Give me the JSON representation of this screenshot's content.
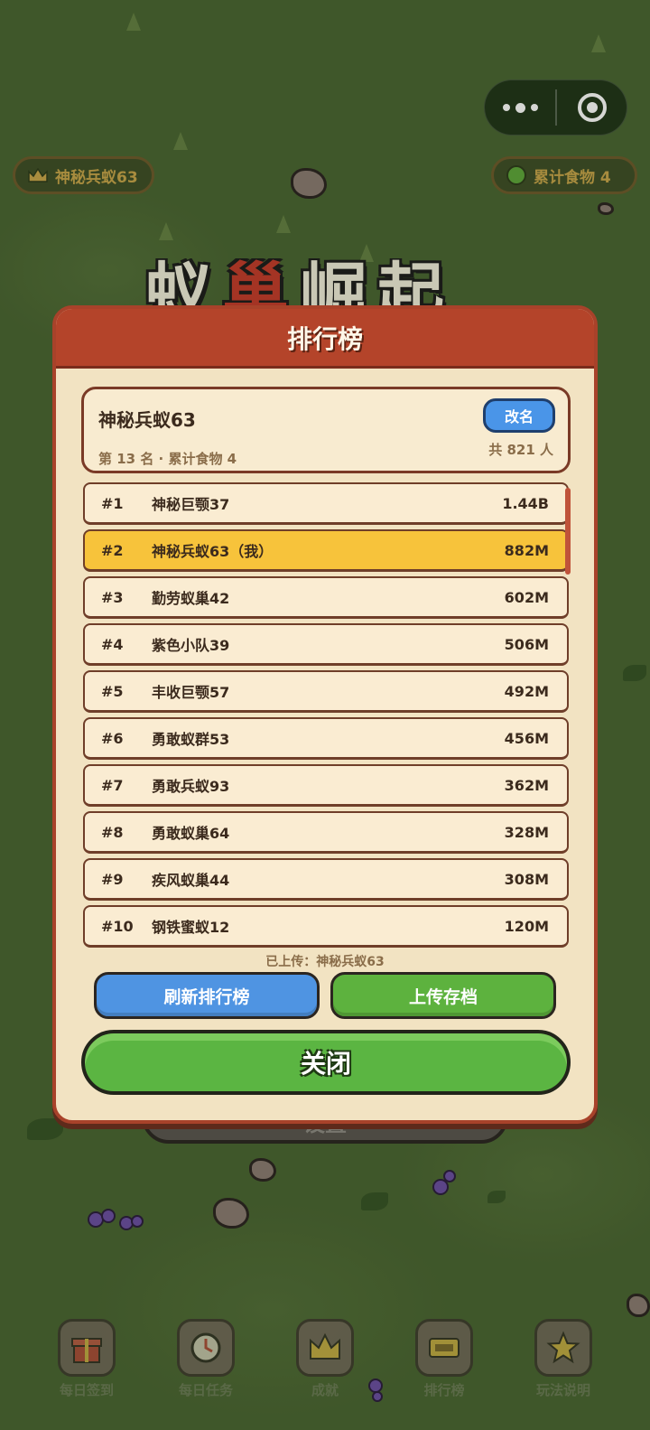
{
  "top_chips": {
    "player": "神秘兵蚁63",
    "food": "累计食物 4"
  },
  "game_title": {
    "part1": "蚁",
    "part2": "巢",
    "part3": "崛起"
  },
  "behind_button": "设置",
  "leaderboard": {
    "title": "排行榜",
    "me": {
      "name": "神秘兵蚁63",
      "rename_label": "改名",
      "summary": "第 13 名 · 累计食物 4",
      "total": "共 821 人"
    },
    "rows": [
      {
        "rank": "#1",
        "name": "神秘巨颚37",
        "score": "1.44B"
      },
      {
        "rank": "#2",
        "name": "神秘兵蚁63（我）",
        "score": "882M"
      },
      {
        "rank": "#3",
        "name": "勤劳蚁巢42",
        "score": "602M"
      },
      {
        "rank": "#4",
        "name": "紫色小队39",
        "score": "506M"
      },
      {
        "rank": "#5",
        "name": "丰收巨颚57",
        "score": "492M"
      },
      {
        "rank": "#6",
        "name": "勇敢蚁群53",
        "score": "456M"
      },
      {
        "rank": "#7",
        "name": "勇敢兵蚁93",
        "score": "362M"
      },
      {
        "rank": "#8",
        "name": "勇敢蚁巢64",
        "score": "328M"
      },
      {
        "rank": "#9",
        "name": "疾风蚁巢44",
        "score": "308M"
      },
      {
        "rank": "#10",
        "name": "钢铁蜜蚁12",
        "score": "120M"
      }
    ],
    "uploaded_text": "已上传：神秘兵蚁63",
    "refresh_label": "刷新排行榜",
    "upload_label": "上传存档",
    "close_label": "关闭"
  },
  "bottom_nav": [
    {
      "label": "每日签到",
      "icon": "gift-icon"
    },
    {
      "label": "每日任务",
      "icon": "clock-icon"
    },
    {
      "label": "成就",
      "icon": "crown-icon"
    },
    {
      "label": "排行榜",
      "icon": "board-icon"
    },
    {
      "label": "玩法说明",
      "icon": "star-icon"
    }
  ],
  "colors": {
    "header": "#b4442a",
    "highlight_row": "#f7c33b",
    "refresh": "#4f94e2",
    "upload": "#5db23e",
    "close": "#5bb542"
  }
}
